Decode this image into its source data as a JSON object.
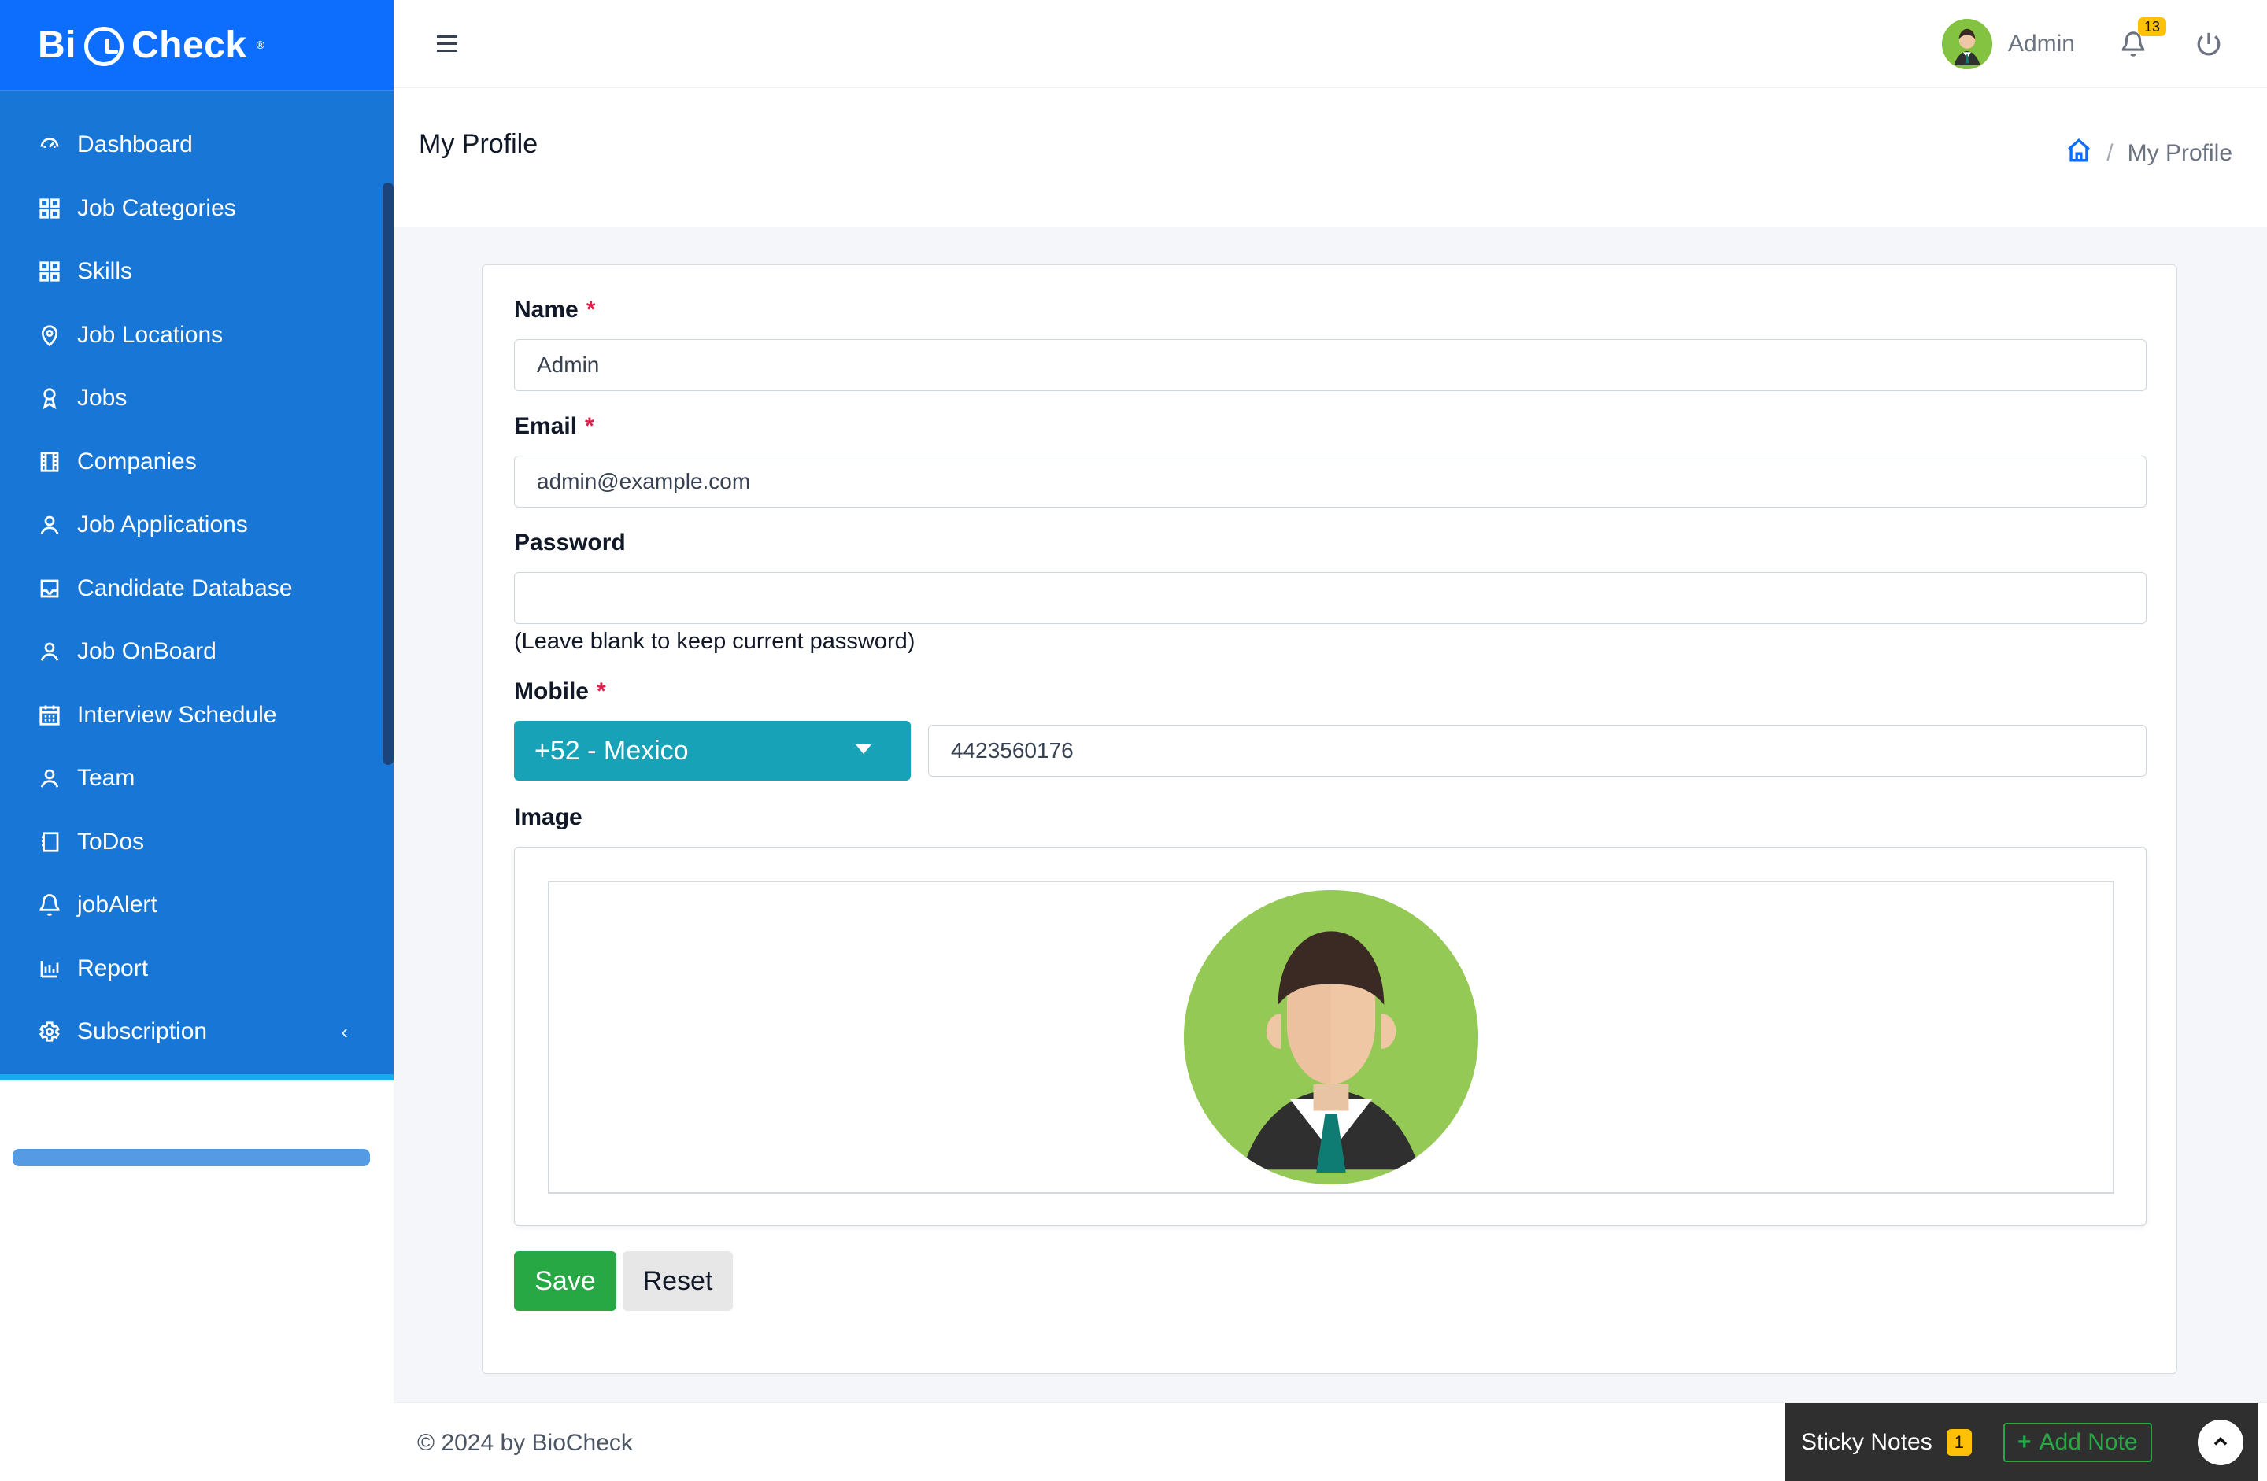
{
  "brand": {
    "logo_text_left": "Bi",
    "logo_text_right": "Check",
    "trademark": "®",
    "colors": {
      "sidebar": "#1877d6",
      "sidebar_top": "#0d6efd",
      "accent": "#19a9ef",
      "teal": "#17a2b8",
      "green": "#28a745",
      "badge": "#ffc107"
    }
  },
  "sidebar": {
    "items": [
      {
        "label": "Dashboard",
        "icon": "dashboard-icon"
      },
      {
        "label": "Job Categories",
        "icon": "grid-icon"
      },
      {
        "label": "Skills",
        "icon": "grid-icon"
      },
      {
        "label": "Job Locations",
        "icon": "location-pin-icon"
      },
      {
        "label": "Jobs",
        "icon": "award-icon"
      },
      {
        "label": "Companies",
        "icon": "film-icon"
      },
      {
        "label": "Job Applications",
        "icon": "user-icon"
      },
      {
        "label": "Candidate Database",
        "icon": "inbox-icon"
      },
      {
        "label": "Job OnBoard",
        "icon": "user-icon"
      },
      {
        "label": "Interview Schedule",
        "icon": "calendar-icon"
      },
      {
        "label": "Team",
        "icon": "user-icon"
      },
      {
        "label": "ToDos",
        "icon": "notebook-icon"
      },
      {
        "label": "jobAlert",
        "icon": "bell-icon"
      },
      {
        "label": "Report",
        "icon": "bar-chart-icon"
      },
      {
        "label": "Subscription",
        "icon": "gear-icon",
        "chevron": "‹"
      }
    ]
  },
  "header": {
    "user_name": "Admin",
    "notifications_count": "13"
  },
  "page": {
    "title": "My Profile",
    "breadcrumb_current": "My Profile",
    "breadcrumb_separator": "/"
  },
  "form": {
    "name": {
      "label": "Name",
      "required": "*",
      "value": "Admin"
    },
    "email": {
      "label": "Email",
      "required": "*",
      "value": "admin@example.com"
    },
    "password": {
      "label": "Password",
      "value": "",
      "help": "(Leave blank to keep current password)"
    },
    "mobile": {
      "label": "Mobile",
      "required": "*",
      "country": "+52 - Mexico",
      "value": "4423560176"
    },
    "image": {
      "label": "Image"
    },
    "buttons": {
      "save": "Save",
      "reset": "Reset"
    }
  },
  "footer": {
    "copyright": "© 2024 by BioCheck",
    "sticky_notes_label": "Sticky Notes",
    "sticky_notes_count": "1",
    "add_note_label": "Add Note",
    "add_note_plus": "+"
  }
}
